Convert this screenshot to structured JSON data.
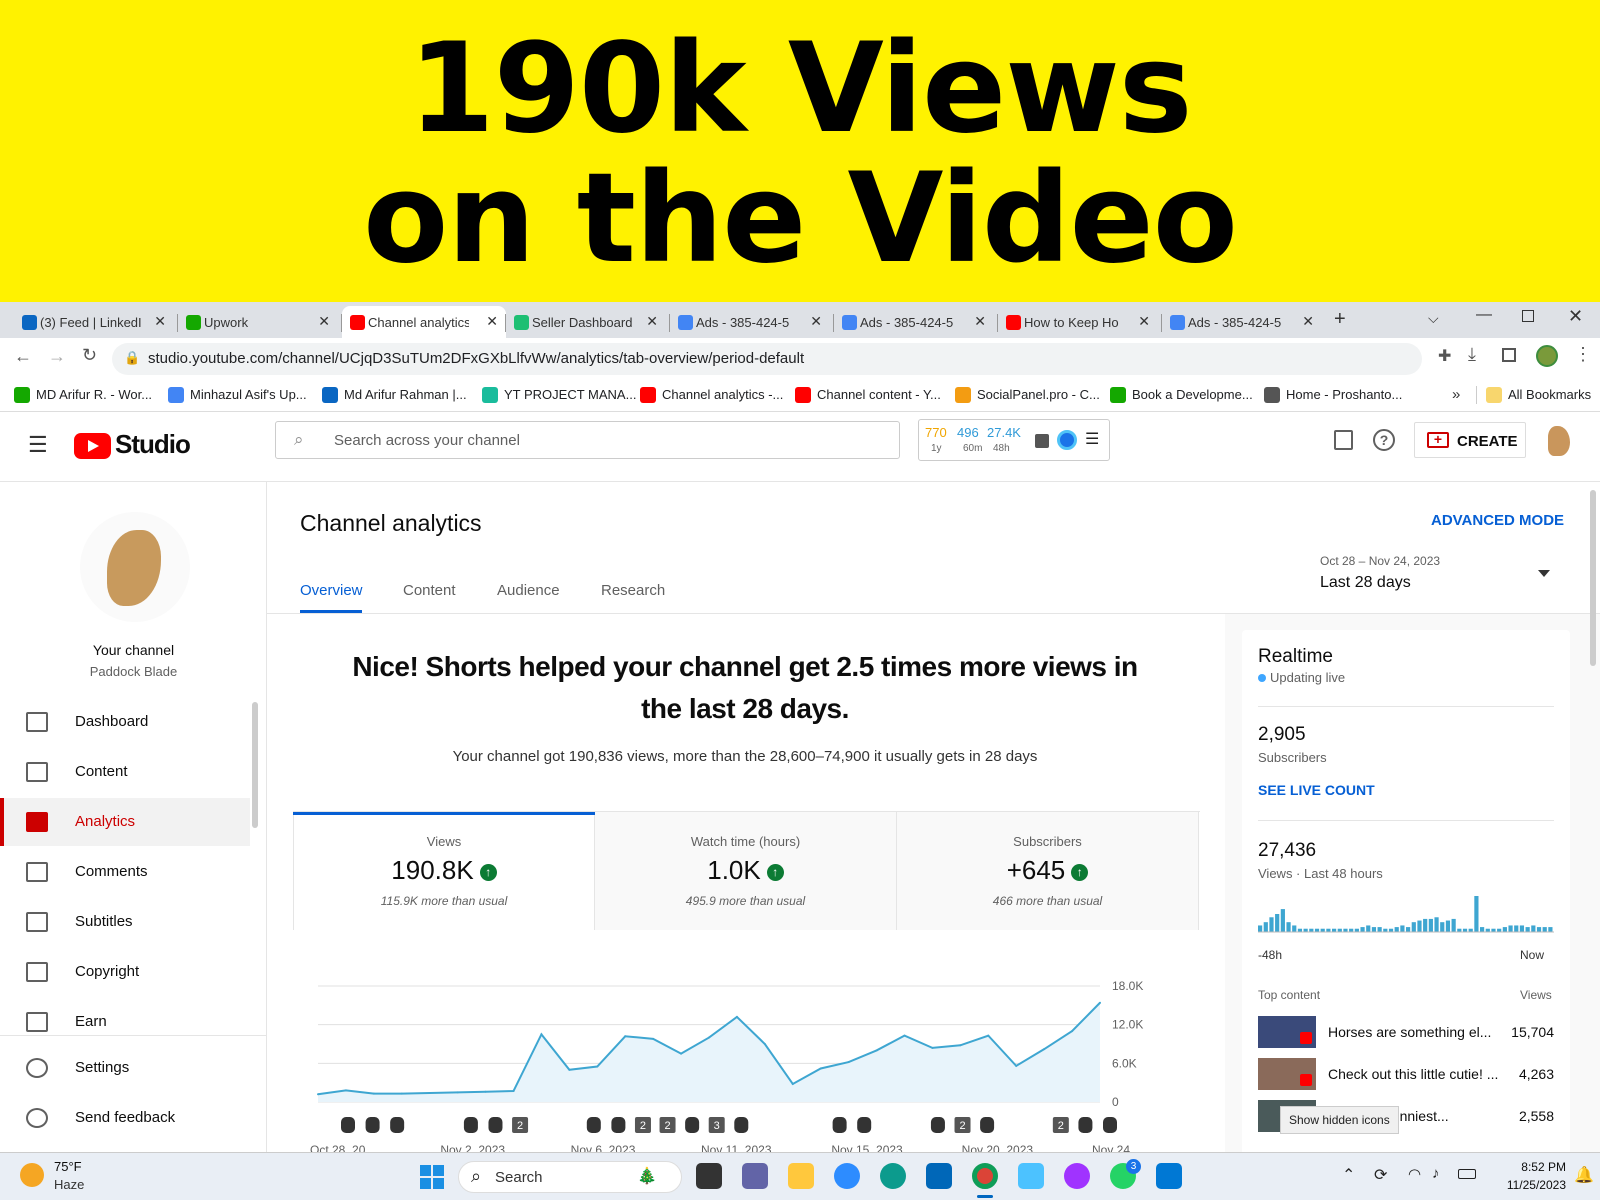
{
  "banner": {
    "line1": "190k Views",
    "line2": "on the Video"
  },
  "tabs": [
    {
      "title": "(3) Feed | LinkedIn",
      "color": "#0a66c2"
    },
    {
      "title": "Upwork",
      "color": "#14a800"
    },
    {
      "title": "Channel analytics",
      "color": "#ff0000"
    },
    {
      "title": "Seller Dashboard",
      "color": "#1dbf73"
    },
    {
      "title": "Ads - 385-424-5",
      "color": "#4285f4"
    },
    {
      "title": "Ads - 385-424-5",
      "color": "#4285f4"
    },
    {
      "title": "How to Keep Ho",
      "color": "#ff0000"
    },
    {
      "title": "Ads - 385-424-5",
      "color": "#4285f4"
    }
  ],
  "browser": {
    "url": "studio.youtube.com/channel/UCjqD3SuTUm2DFxGXbLlfvWw/analytics/tab-overview/period-default"
  },
  "bookmarks": [
    {
      "label": "MD Arifur R. - Wor...",
      "color": "#14a800"
    },
    {
      "label": "Minhazul Asif's Up...",
      "color": "#4285f4"
    },
    {
      "label": "Md Arifur Rahman |...",
      "color": "#0a66c2"
    },
    {
      "label": "YT PROJECT MANA...",
      "color": "#1abc9c"
    },
    {
      "label": "Channel analytics -...",
      "color": "#ff0000"
    },
    {
      "label": "Channel content - Y...",
      "color": "#ff0000"
    },
    {
      "label": "SocialPanel.pro - C...",
      "color": "#f39c12"
    },
    {
      "label": "Book a Developme...",
      "color": "#14a800"
    },
    {
      "label": "Home - Proshanto...",
      "color": "#555555"
    }
  ],
  "bookmarks_more": "»",
  "all_bookmarks": "All Bookmarks",
  "studio": {
    "logo_text": "Studio",
    "search_placeholder": "Search across your channel",
    "stats": [
      {
        "v": "770",
        "s": "1y",
        "c": "#f0a500"
      },
      {
        "v": "496",
        "s": "60m",
        "c": "#2f9ad8"
      },
      {
        "v": "27.4K",
        "s": "48h",
        "c": "#2f9ad8"
      }
    ],
    "create_label": "CREATE"
  },
  "sidebar": {
    "channel_label": "Your channel",
    "channel_name": "Paddock Blade",
    "items": [
      "Dashboard",
      "Content",
      "Analytics",
      "Comments",
      "Subtitles",
      "Copyright",
      "Earn"
    ],
    "bottom": [
      "Settings",
      "Send feedback"
    ]
  },
  "page": {
    "title": "Channel analytics",
    "advanced": "ADVANCED MODE",
    "tabs": [
      "Overview",
      "Content",
      "Audience",
      "Research"
    ],
    "date_range": "Oct 28 – Nov 24, 2023",
    "period": "Last 28 days",
    "headline": "Nice! Shorts helped your channel get 2.5 times more views in the last 28 days.",
    "subline": "Your channel got 190,836 views, more than the 28,600–74,900 it usually gets in 28 days"
  },
  "metrics": [
    {
      "label": "Views",
      "value": "190.8K",
      "note": "115.9K more than usual"
    },
    {
      "label": "Watch time (hours)",
      "value": "1.0K",
      "note": "495.9 more than usual"
    },
    {
      "label": "Subscribers",
      "value": "+645",
      "note": "466 more than usual"
    }
  ],
  "chart_data": {
    "type": "area",
    "x_ticks": [
      "Oct 28, 20...",
      "Nov 2, 2023",
      "Nov 6, 2023",
      "Nov 11, 2023",
      "Nov 15, 2023",
      "Nov 20, 2023",
      "Nov 24,..."
    ],
    "y_ticks": [
      "18.0K",
      "12.0K",
      "6.0K",
      "0"
    ],
    "ylim": [
      0,
      18000
    ],
    "values": [
      1200,
      1800,
      1300,
      1300,
      1400,
      1500,
      1600,
      1700,
      10500,
      5000,
      5500,
      10200,
      9800,
      7500,
      10000,
      13200,
      9000,
      2800,
      5200,
      6200,
      8000,
      10300,
      8400,
      8800,
      10300,
      5600,
      8200,
      11000,
      15400
    ],
    "badges": [
      "s",
      "s",
      "s",
      "",
      "",
      "s",
      "s",
      "2",
      "",
      "",
      "s",
      "s",
      "2",
      "2",
      "s",
      "3",
      "s",
      "",
      "",
      "",
      "s",
      "s",
      "",
      "",
      "s",
      "2",
      "s",
      "",
      "",
      "2",
      "s",
      "s"
    ],
    "color": "#3ea6d1"
  },
  "realtime": {
    "title": "Realtime",
    "status": "Updating live",
    "subs_value": "2,905",
    "subs_label": "Subscribers",
    "live_link": "SEE LIVE COUNT",
    "views_value": "27,436",
    "views_label": "Views · Last 48 hours",
    "bars": [
      4,
      6,
      9,
      11,
      14,
      6,
      4,
      2,
      2,
      2,
      2,
      2,
      2,
      2,
      2,
      2,
      2,
      2,
      3,
      4,
      3,
      3,
      2,
      2,
      3,
      4,
      3,
      6,
      7,
      8,
      8,
      9,
      6,
      7,
      8,
      2,
      2,
      2,
      22,
      3,
      2,
      2,
      2,
      3,
      4,
      4,
      4,
      3,
      4,
      3,
      3,
      3
    ],
    "axis_left": "-48h",
    "axis_right": "Now",
    "top_label": "Top content",
    "top_views_label": "Views",
    "top": [
      {
        "title": "Horses are something el...",
        "views": "15,704"
      },
      {
        "title": "Check out this little cutie! ...",
        "views": "4,263"
      },
      {
        "title": "Have the funniest...",
        "views": "2,558"
      }
    ],
    "tooltip": "Show hidden icons"
  },
  "taskbar": {
    "weather_temp": "75°F",
    "weather_desc": "Haze",
    "search": "Search",
    "time": "8:52 PM",
    "date": "11/25/2023",
    "whatsapp_badge": "3"
  }
}
